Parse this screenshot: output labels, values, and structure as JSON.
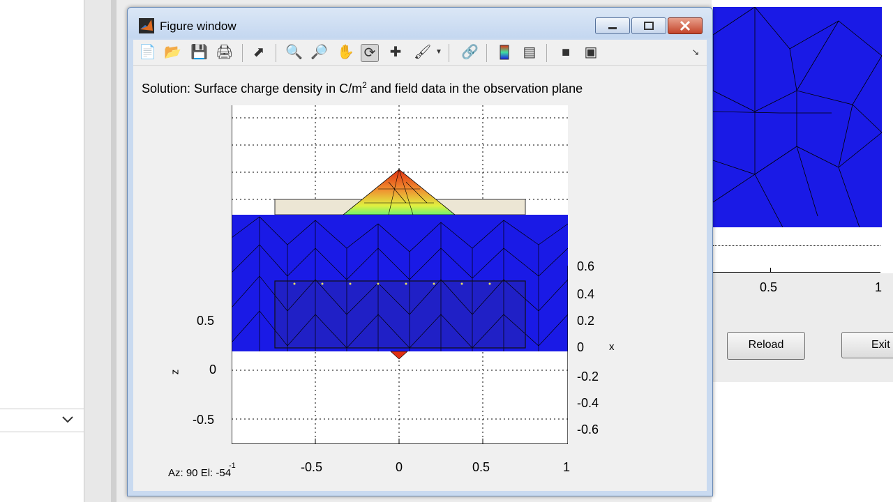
{
  "figure_window": {
    "title": "Figure window",
    "heading_prefix": "Solution: Surface charge density in C/m",
    "heading_superscript": "2",
    "heading_suffix": " and field data in the observation plane",
    "view_readout": "Az:   90 El: -54",
    "toolbar_icons": [
      "new-figure-icon",
      "open-file-icon",
      "save-icon",
      "print-icon",
      "select-arrow-icon",
      "zoom-in-icon",
      "zoom-out-icon",
      "pan-hand-icon",
      "rotate-3d-icon",
      "data-cursor-icon",
      "brush-icon",
      "brush-dropdown-icon",
      "link-plot-icon",
      "colorbar-icon",
      "legend-icon",
      "hide-plot-tools-icon",
      "show-plot-tools-icon",
      "dock-icon"
    ]
  },
  "plot": {
    "x_ticks": [
      "-0.5",
      "0",
      "0.5",
      "1"
    ],
    "x_first_tick": "-1",
    "z_ticks": [
      "0.5",
      "0",
      "-0.5"
    ],
    "z_label": "z",
    "x3d_ticks": [
      "0.6",
      "0.4",
      "0.2",
      "0",
      "-0.2",
      "-0.4",
      "-0.6"
    ],
    "x3d_label": "x",
    "colors": {
      "mesh_blue": "#1a1ae6",
      "hot_red": "#e03010",
      "hot_yellow": "#f0e040",
      "box_beige": "#ece6d4"
    }
  },
  "background_gui": {
    "x_ticks": [
      "0.5",
      "1"
    ],
    "reload_label": "Reload",
    "exit_label": "Exit"
  }
}
